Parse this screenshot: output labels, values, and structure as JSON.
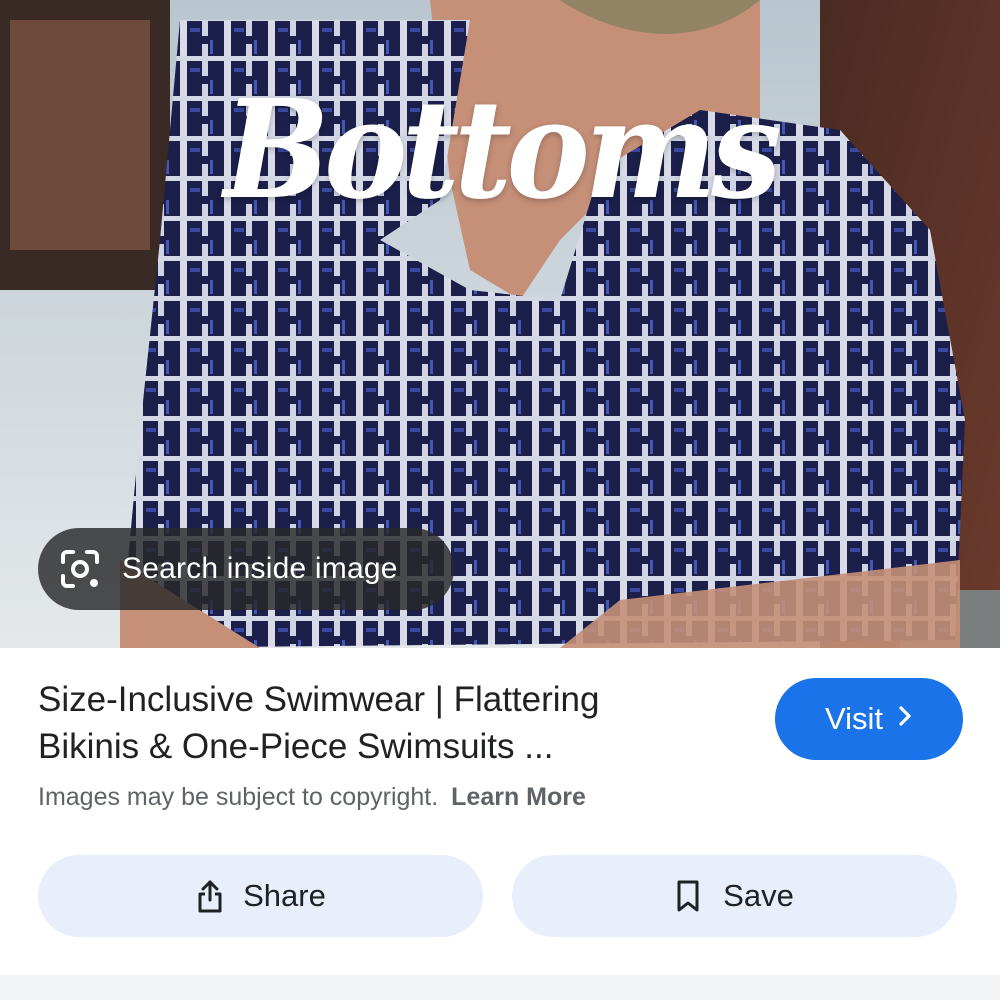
{
  "image": {
    "overlay_text": "Bottoms",
    "search_chip": {
      "icon": "lens-camera-icon",
      "label": "Search inside image"
    }
  },
  "result": {
    "title_line1": "Size-Inclusive Swimwear | Flattering",
    "title_line2": "Bikinis & One-Piece Swimsuits ...",
    "visit_label": "Visit",
    "visit_icon": "chevron-right-icon",
    "copyright_text": "Images may be subject to copyright.",
    "learn_more_label": "Learn More"
  },
  "actions": {
    "share_label": "Share",
    "share_icon": "share-icon",
    "save_label": "Save",
    "save_icon": "bookmark-icon"
  },
  "colors": {
    "accent": "#1a73e8",
    "button_bg": "#e8eefa",
    "chip_bg": "#28282a",
    "text_primary": "#202124",
    "text_secondary": "#5f6368"
  }
}
